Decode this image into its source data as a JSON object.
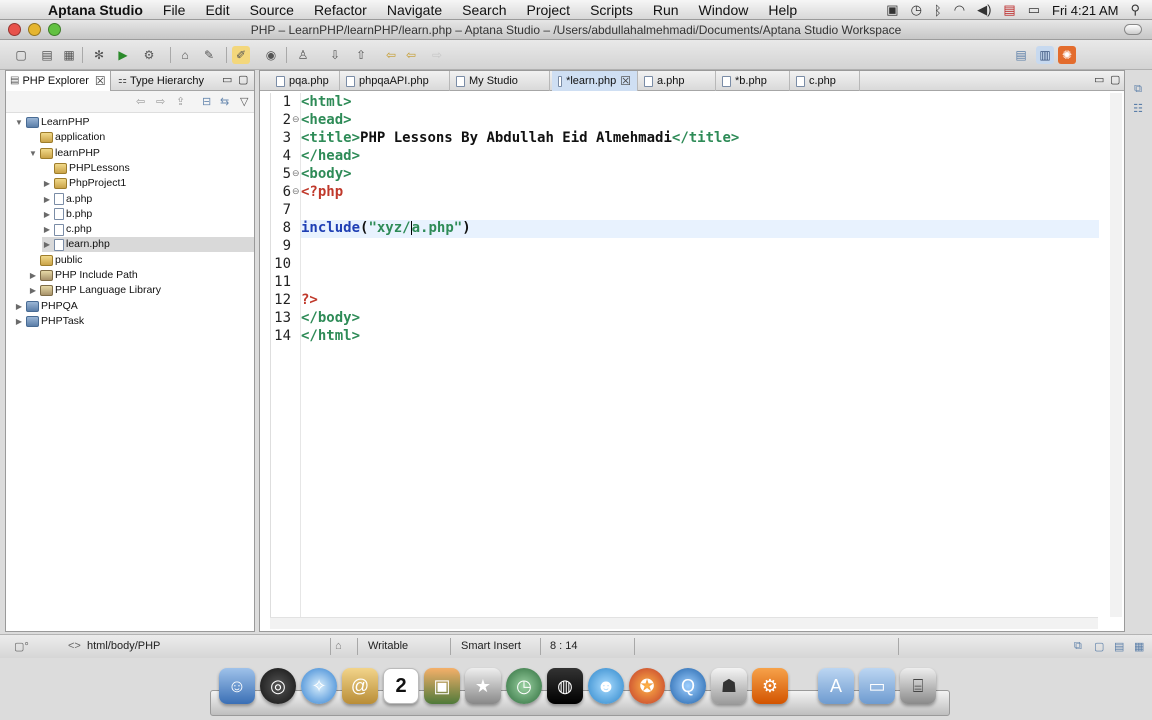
{
  "menubar": {
    "app_name": "Aptana Studio",
    "items": [
      "File",
      "Edit",
      "Source",
      "Refactor",
      "Navigate",
      "Search",
      "Project",
      "Scripts",
      "Run",
      "Window",
      "Help"
    ],
    "clock": "Fri 4:21 AM",
    "status_icons": [
      "screen-icon",
      "time-machine-icon",
      "bluetooth-icon",
      "wifi-icon",
      "volume-icon",
      "flag-icon",
      "battery-icon",
      "spotlight-icon"
    ]
  },
  "window": {
    "title": "PHP – LearnPHP/learnPHP/learn.php – Aptana Studio – /Users/abdullahalmehmadi/Documents/Aptana Studio Workspace"
  },
  "left_panel": {
    "tabs": [
      {
        "label": "PHP Explorer",
        "active": true
      },
      {
        "label": "Type Hierarchy",
        "active": false
      }
    ],
    "tree": [
      {
        "label": "LearnPHP",
        "indent": 0,
        "icon": "project",
        "twisty": "▼"
      },
      {
        "label": "application",
        "indent": 1,
        "icon": "folder",
        "twisty": ""
      },
      {
        "label": "learnPHP",
        "indent": 1,
        "icon": "folder",
        "twisty": "▼"
      },
      {
        "label": "PHPLessons",
        "indent": 2,
        "icon": "folder",
        "twisty": ""
      },
      {
        "label": "PhpProject1",
        "indent": 2,
        "icon": "folder",
        "twisty": "▶"
      },
      {
        "label": "a.php",
        "indent": 2,
        "icon": "file",
        "twisty": "▶"
      },
      {
        "label": "b.php",
        "indent": 2,
        "icon": "file",
        "twisty": "▶"
      },
      {
        "label": "c.php",
        "indent": 2,
        "icon": "file",
        "twisty": "▶"
      },
      {
        "label": "learn.php",
        "indent": 2,
        "icon": "file",
        "twisty": "▶",
        "selected": true
      },
      {
        "label": "public",
        "indent": 1,
        "icon": "folder",
        "twisty": ""
      },
      {
        "label": "PHP Include Path",
        "indent": 1,
        "icon": "lib",
        "twisty": "▶"
      },
      {
        "label": "PHP Language Library",
        "indent": 1,
        "icon": "lib",
        "twisty": "▶"
      },
      {
        "label": "PHPQA",
        "indent": 0,
        "icon": "project",
        "twisty": "▶"
      },
      {
        "label": "PHPTask",
        "indent": 0,
        "icon": "project",
        "twisty": "▶"
      }
    ]
  },
  "editor": {
    "tabs": [
      {
        "label": "pqa.php",
        "active": false
      },
      {
        "label": "phpqaAPI.php",
        "active": false
      },
      {
        "label": "My Studio",
        "active": false
      },
      {
        "label": "*learn.php",
        "active": true
      },
      {
        "label": "a.php",
        "active": false
      },
      {
        "label": "*b.php",
        "active": false
      },
      {
        "label": "c.php",
        "active": false
      }
    ],
    "lines": [
      {
        "n": "1",
        "fold": "",
        "parts": [
          {
            "t": "<html>",
            "c": "tag"
          }
        ]
      },
      {
        "n": "2",
        "fold": "⊖",
        "parts": [
          {
            "t": "<head>",
            "c": "tag"
          }
        ]
      },
      {
        "n": "3",
        "fold": "",
        "parts": [
          {
            "t": "<title>",
            "c": "tag"
          },
          {
            "t": "PHP Lessons By Abdullah Eid Almehmadi",
            "c": "text"
          },
          {
            "t": "</title>",
            "c": "tag"
          }
        ]
      },
      {
        "n": "4",
        "fold": "",
        "parts": [
          {
            "t": "</head>",
            "c": "tag"
          }
        ]
      },
      {
        "n": "5",
        "fold": "⊖",
        "parts": [
          {
            "t": "<body>",
            "c": "tag"
          }
        ]
      },
      {
        "n": "6",
        "fold": "⊖",
        "parts": [
          {
            "t": "<?php",
            "c": "php"
          }
        ]
      },
      {
        "n": "7",
        "fold": "",
        "parts": []
      },
      {
        "n": "8",
        "fold": "",
        "current": true,
        "parts": [
          {
            "t": "include",
            "c": "kw"
          },
          {
            "t": "(",
            "c": "text"
          },
          {
            "t": "\"xyz/",
            "c": "str"
          },
          {
            "t": "|",
            "c": "cursor"
          },
          {
            "t": "a.php\"",
            "c": "str"
          },
          {
            "t": ")",
            "c": "text"
          }
        ]
      },
      {
        "n": "9",
        "fold": "",
        "parts": []
      },
      {
        "n": "10",
        "fold": "",
        "parts": []
      },
      {
        "n": "11",
        "fold": "",
        "parts": []
      },
      {
        "n": "12",
        "fold": "",
        "parts": [
          {
            "t": "?>",
            "c": "php"
          }
        ]
      },
      {
        "n": "13",
        "fold": "",
        "parts": [
          {
            "t": "</body>",
            "c": "tag"
          }
        ]
      },
      {
        "n": "14",
        "fold": "",
        "parts": [
          {
            "t": "</html>",
            "c": "tag"
          }
        ]
      }
    ]
  },
  "statusbar": {
    "breadcrumb": "html/body/PHP",
    "mode": "Writable",
    "insert": "Smart Insert",
    "position": "8 : 14"
  },
  "colors": {
    "tag": "#2e8b57",
    "php": "#c0392b",
    "keyword": "#1f3fb4",
    "current_line": "#e8f2fe",
    "active_tab": "#cfdff3"
  },
  "dock": {
    "calendar_day": "2",
    "apps": [
      "finder-icon",
      "dashboard-icon",
      "safari-icon",
      "mail-icon",
      "calendar-icon",
      "iphoto-icon",
      "imovie-icon",
      "time-machine-icon",
      "zoin-icon",
      "messenger-icon",
      "firefox-icon",
      "quicktime-icon",
      "preferences-user-icon",
      "system-preferences-icon",
      "applications-folder-icon",
      "documents-folder-icon",
      "trash-icon"
    ]
  }
}
